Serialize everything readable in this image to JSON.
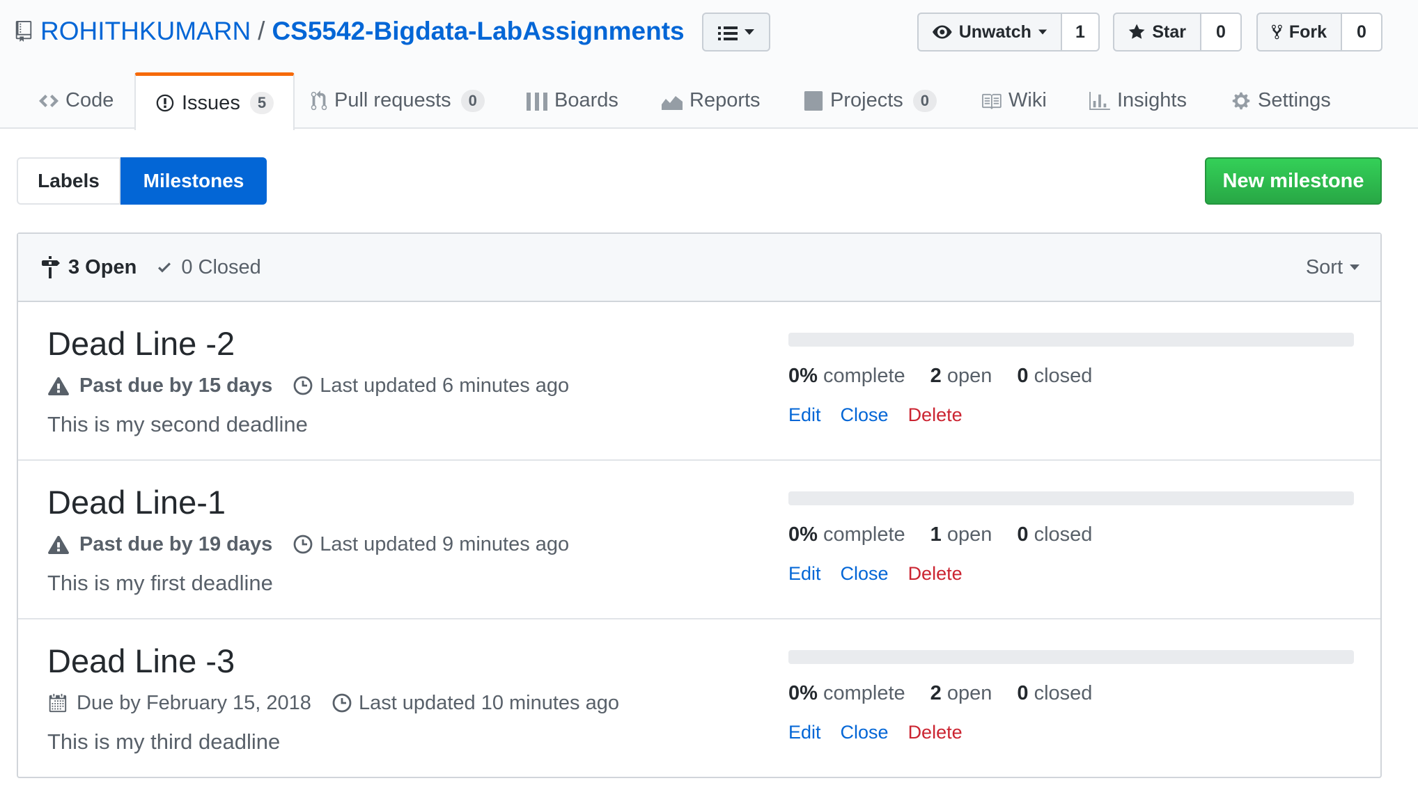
{
  "repo": {
    "owner": "ROHITHKUMARN",
    "separator": "/",
    "name": "CS5542-Bigdata-LabAssignments"
  },
  "actions": {
    "unwatch": {
      "label": "Unwatch",
      "count": "1"
    },
    "star": {
      "label": "Star",
      "count": "0"
    },
    "fork": {
      "label": "Fork",
      "count": "0"
    }
  },
  "tabs": [
    {
      "label": "Code",
      "icon": "code-icon"
    },
    {
      "label": "Issues",
      "icon": "issue-opened-icon",
      "count": "5",
      "selected": true
    },
    {
      "label": "Pull requests",
      "icon": "git-pull-request-icon",
      "count": "0"
    },
    {
      "label": "Boards",
      "icon": "boards-icon"
    },
    {
      "label": "Reports",
      "icon": "graph-icon"
    },
    {
      "label": "Projects",
      "icon": "project-icon",
      "count": "0"
    },
    {
      "label": "Wiki",
      "icon": "book-icon"
    },
    {
      "label": "Insights",
      "icon": "insights-icon"
    },
    {
      "label": "Settings",
      "icon": "gear-icon"
    }
  ],
  "subnav": {
    "labels": "Labels",
    "milestones": "Milestones"
  },
  "new_milestone": "New milestone",
  "list_header": {
    "open": "3 Open",
    "closed": "0 Closed",
    "sort": "Sort"
  },
  "milestones": [
    {
      "title": "Dead Line -2",
      "due": "Past due by 15 days",
      "due_icon": "alert-icon",
      "updated": "Last updated 6 minutes ago",
      "description": "This is my second deadline",
      "progress": 0,
      "complete_pct": "0%",
      "complete_label": "complete",
      "open_count": "2",
      "open_label": "open",
      "closed_count": "0",
      "closed_label": "closed",
      "edit": "Edit",
      "close": "Close",
      "delete": "Delete"
    },
    {
      "title": "Dead Line-1",
      "due": "Past due by 19 days",
      "due_icon": "alert-icon",
      "updated": "Last updated 9 minutes ago",
      "description": "This is my first deadline",
      "progress": 0,
      "complete_pct": "0%",
      "complete_label": "complete",
      "open_count": "1",
      "open_label": "open",
      "closed_count": "0",
      "closed_label": "closed",
      "edit": "Edit",
      "close": "Close",
      "delete": "Delete"
    },
    {
      "title": "Dead Line -3",
      "due": "Due by February 15, 2018",
      "due_icon": "calendar-icon",
      "updated": "Last updated 10 minutes ago",
      "description": "This is my third deadline",
      "progress": 0,
      "complete_pct": "0%",
      "complete_label": "complete",
      "open_count": "2",
      "open_label": "open",
      "closed_count": "0",
      "closed_label": "closed",
      "edit": "Edit",
      "close": "Close",
      "delete": "Delete"
    }
  ],
  "colors": {
    "link": "#0366d6",
    "accent_tab": "#f66a0a",
    "primary_button": "#28a745",
    "danger": "#cb2431"
  }
}
